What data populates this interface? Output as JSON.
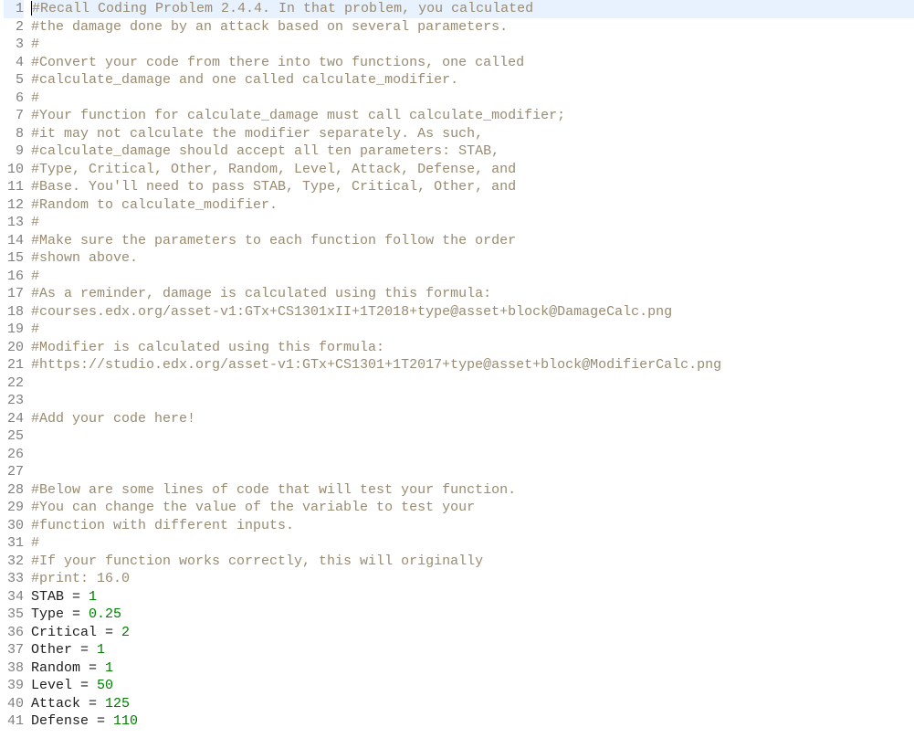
{
  "lines": [
    {
      "n": 1,
      "current": true,
      "tokens": [
        {
          "cls": "comment",
          "text": "#Recall Coding Problem 2.4.4. In that problem, you calculated"
        }
      ],
      "caret_before": true
    },
    {
      "n": 2,
      "tokens": [
        {
          "cls": "comment",
          "text": "#the damage done by an attack based on several parameters."
        }
      ]
    },
    {
      "n": 3,
      "tokens": [
        {
          "cls": "comment",
          "text": "#"
        }
      ]
    },
    {
      "n": 4,
      "tokens": [
        {
          "cls": "comment",
          "text": "#Convert your code from there into two functions, one called"
        }
      ]
    },
    {
      "n": 5,
      "tokens": [
        {
          "cls": "comment",
          "text": "#calculate_damage and one called calculate_modifier."
        }
      ]
    },
    {
      "n": 6,
      "tokens": [
        {
          "cls": "comment",
          "text": "#"
        }
      ]
    },
    {
      "n": 7,
      "tokens": [
        {
          "cls": "comment",
          "text": "#Your function for calculate_damage must call calculate_modifier;"
        }
      ]
    },
    {
      "n": 8,
      "tokens": [
        {
          "cls": "comment",
          "text": "#it may not calculate the modifier separately. As such,"
        }
      ]
    },
    {
      "n": 9,
      "tokens": [
        {
          "cls": "comment",
          "text": "#calculate_damage should accept all ten parameters: STAB,"
        }
      ]
    },
    {
      "n": 10,
      "tokens": [
        {
          "cls": "comment",
          "text": "#Type, Critical, Other, Random, Level, Attack, Defense, and"
        }
      ]
    },
    {
      "n": 11,
      "tokens": [
        {
          "cls": "comment",
          "text": "#Base. You'll need to pass STAB, Type, Critical, Other, and"
        }
      ]
    },
    {
      "n": 12,
      "tokens": [
        {
          "cls": "comment",
          "text": "#Random to calculate_modifier."
        }
      ]
    },
    {
      "n": 13,
      "tokens": [
        {
          "cls": "comment",
          "text": "#"
        }
      ]
    },
    {
      "n": 14,
      "tokens": [
        {
          "cls": "comment",
          "text": "#Make sure the parameters to each function follow the order"
        }
      ]
    },
    {
      "n": 15,
      "tokens": [
        {
          "cls": "comment",
          "text": "#shown above."
        }
      ]
    },
    {
      "n": 16,
      "tokens": [
        {
          "cls": "comment",
          "text": "#"
        }
      ]
    },
    {
      "n": 17,
      "tokens": [
        {
          "cls": "comment",
          "text": "#As a reminder, damage is calculated using this formula:"
        }
      ]
    },
    {
      "n": 18,
      "tokens": [
        {
          "cls": "comment",
          "text": "#courses.edx.org/asset-v1:GTx+CS1301xII+1T2018+type@asset+block@DamageCalc.png"
        }
      ]
    },
    {
      "n": 19,
      "tokens": [
        {
          "cls": "comment",
          "text": "#"
        }
      ]
    },
    {
      "n": 20,
      "tokens": [
        {
          "cls": "comment",
          "text": "#Modifier is calculated using this formula:"
        }
      ]
    },
    {
      "n": 21,
      "tokens": [
        {
          "cls": "comment",
          "text": "#https://studio.edx.org/asset-v1:GTx+CS1301+1T2017+type@asset+block@ModifierCalc.png"
        }
      ]
    },
    {
      "n": 22,
      "tokens": []
    },
    {
      "n": 23,
      "tokens": []
    },
    {
      "n": 24,
      "tokens": [
        {
          "cls": "comment",
          "text": "#Add your code here!"
        }
      ]
    },
    {
      "n": 25,
      "tokens": []
    },
    {
      "n": 26,
      "tokens": []
    },
    {
      "n": 27,
      "tokens": []
    },
    {
      "n": 28,
      "tokens": [
        {
          "cls": "comment",
          "text": "#Below are some lines of code that will test your function."
        }
      ]
    },
    {
      "n": 29,
      "tokens": [
        {
          "cls": "comment",
          "text": "#You can change the value of the variable to test your"
        }
      ]
    },
    {
      "n": 30,
      "tokens": [
        {
          "cls": "comment",
          "text": "#function with different inputs."
        }
      ]
    },
    {
      "n": 31,
      "tokens": [
        {
          "cls": "comment",
          "text": "#"
        }
      ]
    },
    {
      "n": 32,
      "tokens": [
        {
          "cls": "comment",
          "text": "#If your function works correctly, this will originally"
        }
      ]
    },
    {
      "n": 33,
      "tokens": [
        {
          "cls": "comment",
          "text": "#print: 16.0"
        }
      ]
    },
    {
      "n": 34,
      "tokens": [
        {
          "cls": "ident",
          "text": "STAB "
        },
        {
          "cls": "op",
          "text": "= "
        },
        {
          "cls": "number",
          "text": "1"
        }
      ]
    },
    {
      "n": 35,
      "tokens": [
        {
          "cls": "ident",
          "text": "Type "
        },
        {
          "cls": "op",
          "text": "= "
        },
        {
          "cls": "number",
          "text": "0.25"
        }
      ]
    },
    {
      "n": 36,
      "tokens": [
        {
          "cls": "ident",
          "text": "Critical "
        },
        {
          "cls": "op",
          "text": "= "
        },
        {
          "cls": "number",
          "text": "2"
        }
      ]
    },
    {
      "n": 37,
      "tokens": [
        {
          "cls": "ident",
          "text": "Other "
        },
        {
          "cls": "op",
          "text": "= "
        },
        {
          "cls": "number",
          "text": "1"
        }
      ]
    },
    {
      "n": 38,
      "tokens": [
        {
          "cls": "ident",
          "text": "Random "
        },
        {
          "cls": "op",
          "text": "= "
        },
        {
          "cls": "number",
          "text": "1"
        }
      ]
    },
    {
      "n": 39,
      "tokens": [
        {
          "cls": "ident",
          "text": "Level "
        },
        {
          "cls": "op",
          "text": "= "
        },
        {
          "cls": "number",
          "text": "50"
        }
      ]
    },
    {
      "n": 40,
      "tokens": [
        {
          "cls": "ident",
          "text": "Attack "
        },
        {
          "cls": "op",
          "text": "= "
        },
        {
          "cls": "number",
          "text": "125"
        }
      ]
    },
    {
      "n": 41,
      "tokens": [
        {
          "cls": "ident",
          "text": "Defense "
        },
        {
          "cls": "op",
          "text": "= "
        },
        {
          "cls": "number",
          "text": "110"
        }
      ]
    }
  ]
}
